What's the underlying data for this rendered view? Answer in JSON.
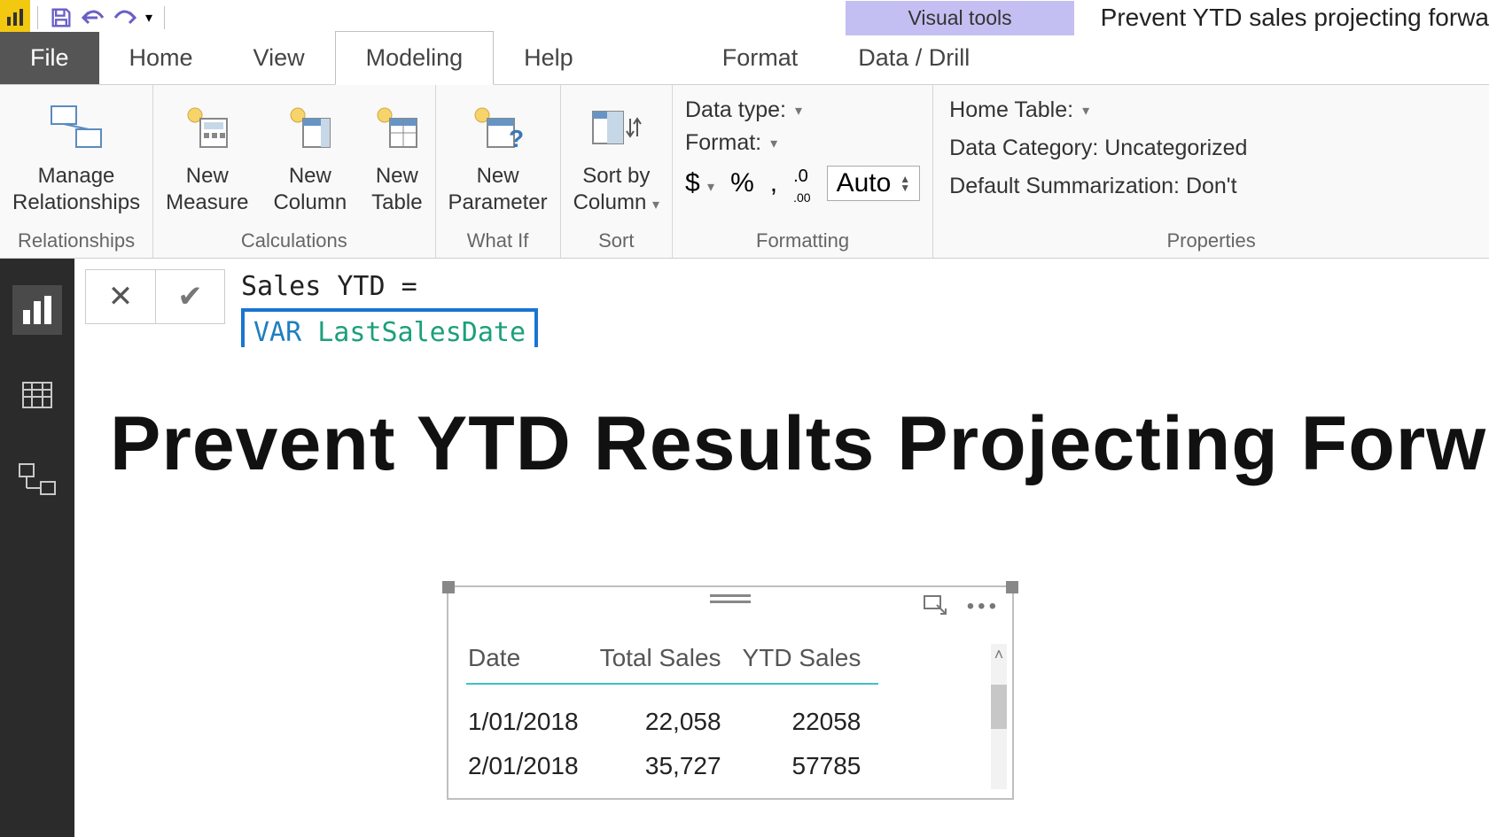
{
  "titlebar": {
    "visual_tools": "Visual tools",
    "doc_title": "Prevent YTD sales projecting forwa"
  },
  "tabs": {
    "file": "File",
    "home": "Home",
    "view": "View",
    "modeling": "Modeling",
    "help": "Help",
    "format": "Format",
    "data_drill": "Data / Drill"
  },
  "ribbon": {
    "relationships_group": "Relationships",
    "manage_relationships": "Manage\nRelationships",
    "calculations_group": "Calculations",
    "new_measure": "New\nMeasure",
    "new_column": "New\nColumn",
    "new_table": "New\nTable",
    "whatif_group": "What If",
    "new_parameter": "New\nParameter",
    "sort_group": "Sort",
    "sort_by_column": "Sort by\nColumn",
    "formatting_group": "Formatting",
    "data_type": "Data type:",
    "format": "Format:",
    "dollar": "$",
    "percent": "%",
    "comma": ",",
    "decimals_icon": ".00",
    "auto": "Auto",
    "properties_group": "Properties",
    "home_table": "Home Table:",
    "data_category": "Data Category: Uncategorized",
    "default_summarization": "Default Summarization: Don't"
  },
  "formula": {
    "line1": "Sales YTD =",
    "var_kw": "VAR",
    "var_name": "LastSalesDate"
  },
  "canvas": {
    "title": "Prevent YTD Results Projecting Forw"
  },
  "table": {
    "headers": {
      "date": "Date",
      "total": "Total Sales",
      "ytd": "YTD Sales"
    },
    "rows": [
      {
        "date": "1/01/2018",
        "total": "22,058",
        "ytd": "22058"
      },
      {
        "date": "2/01/2018",
        "total": "35,727",
        "ytd": "57785"
      }
    ]
  }
}
